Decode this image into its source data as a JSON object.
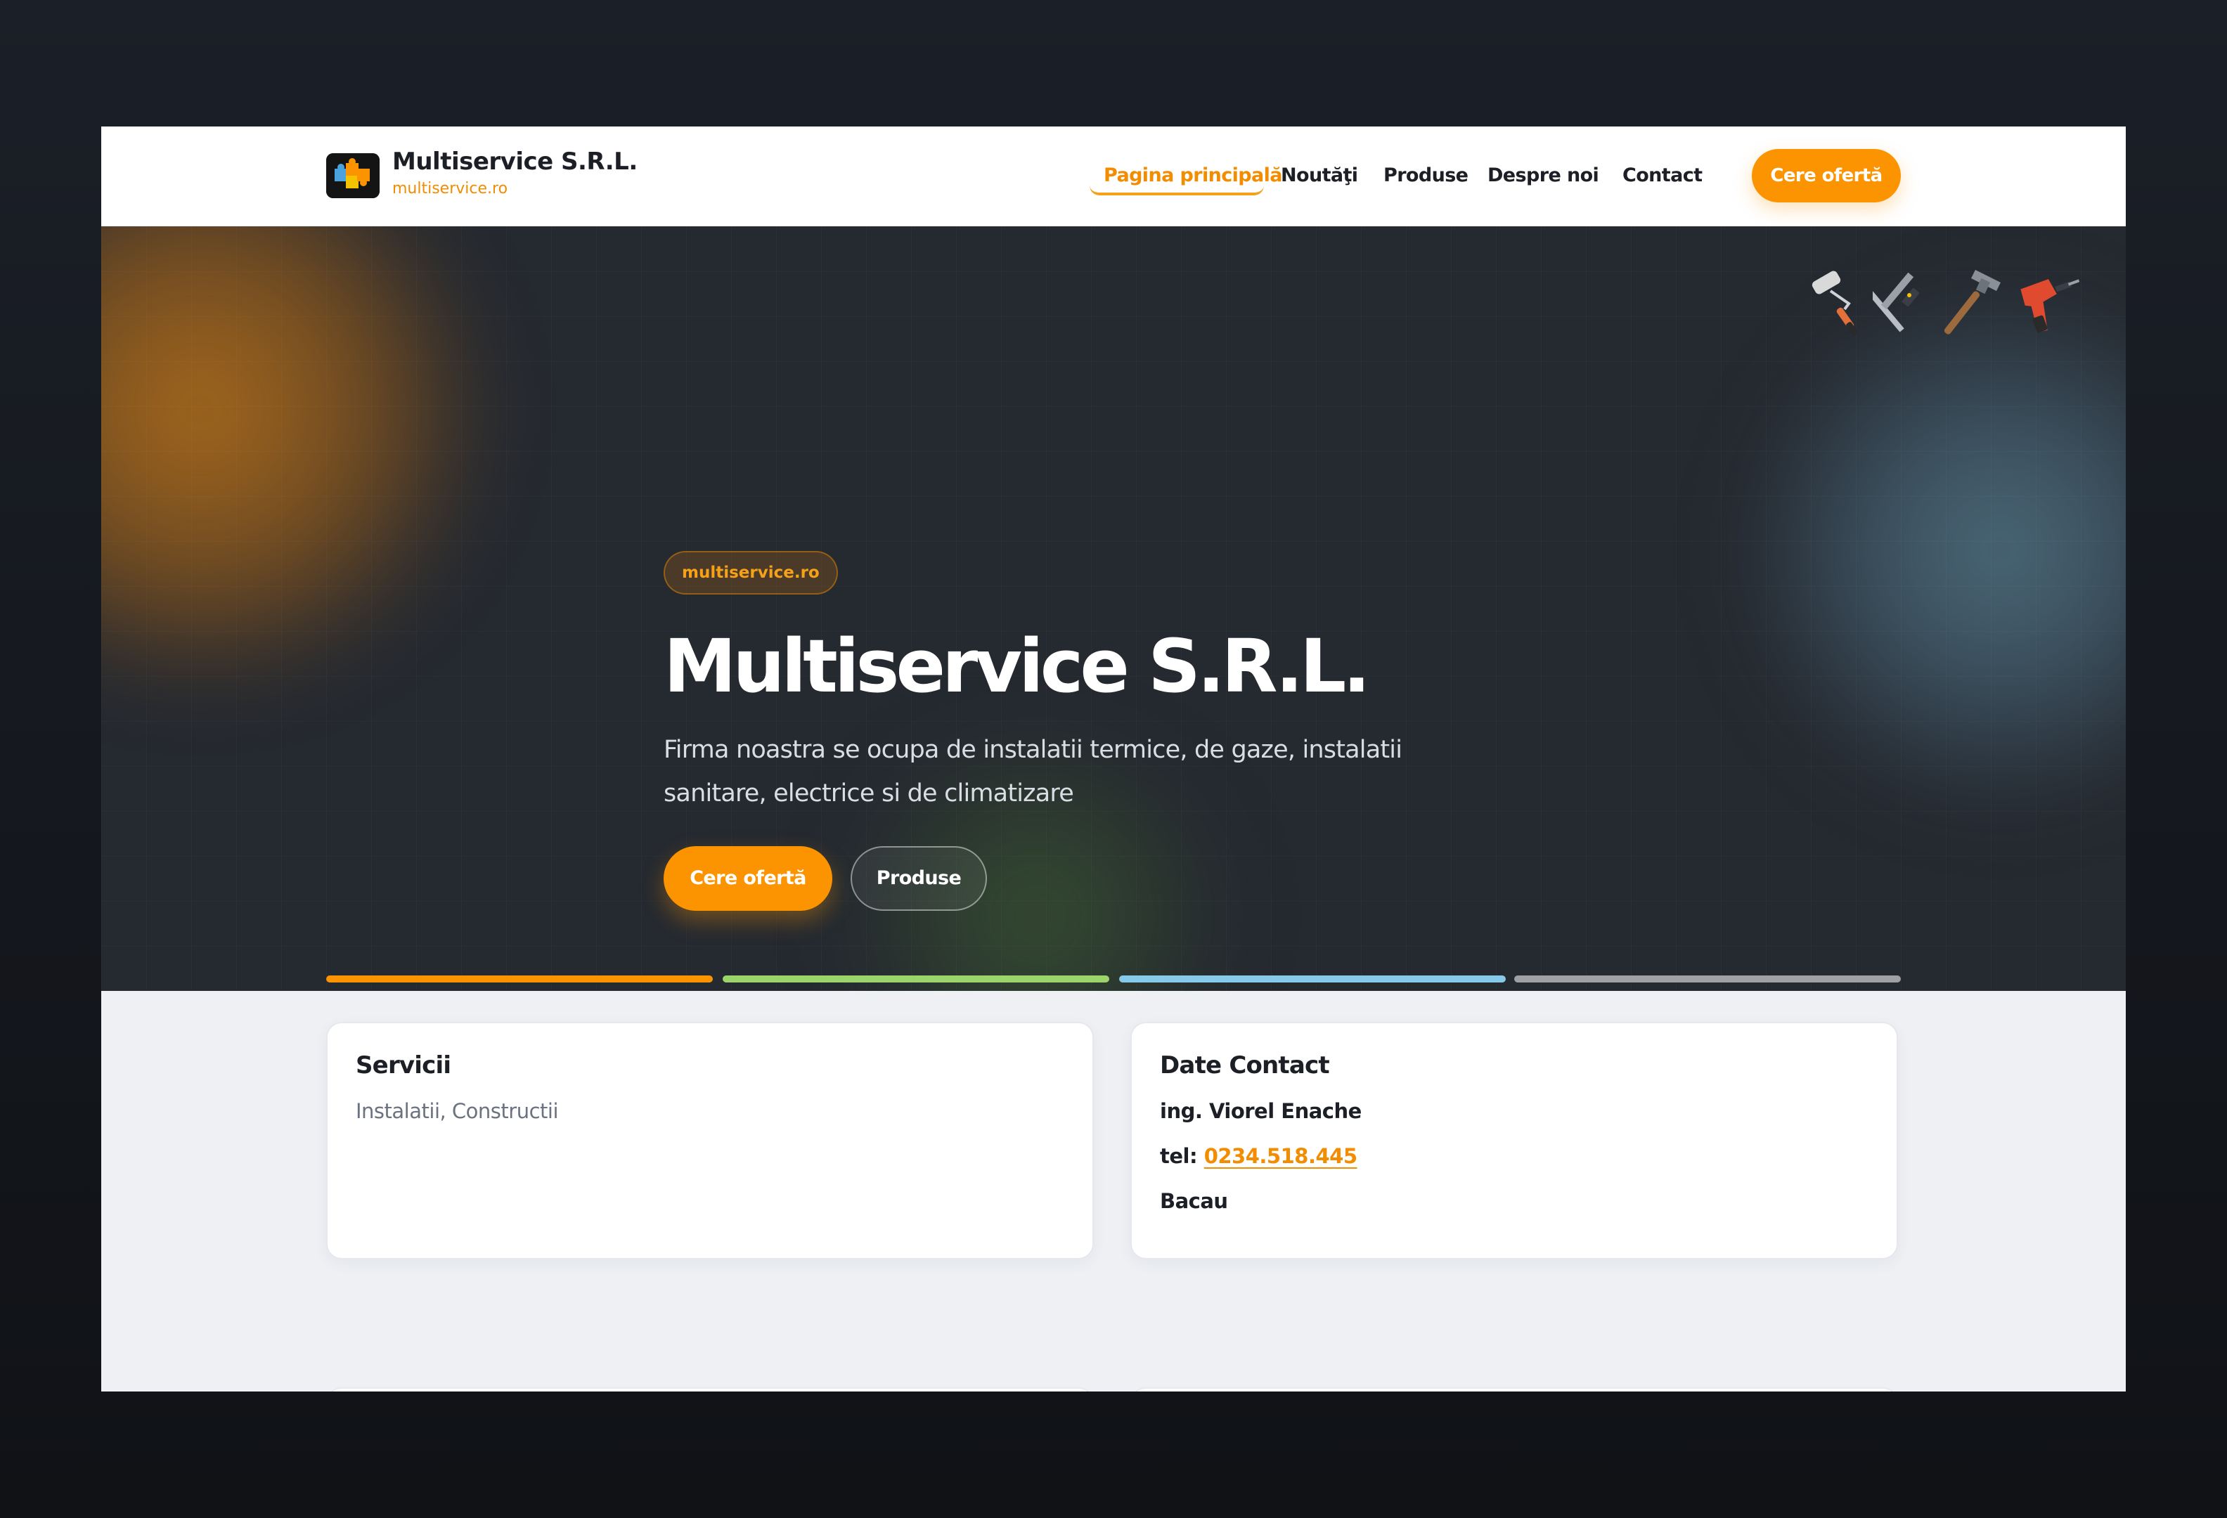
{
  "header": {
    "brand_name": "Multiservice S.R.L.",
    "brand_domain": "multiservice.ro",
    "nav": [
      {
        "label": "Pagina principală",
        "active": true
      },
      {
        "label": "Noutăţi",
        "active": false
      },
      {
        "label": "Produse",
        "active": false
      },
      {
        "label": "Despre noi",
        "active": false
      },
      {
        "label": "Contact",
        "active": false
      }
    ],
    "cta_label": "Cere ofertă"
  },
  "hero": {
    "badge": "multiservice.ro",
    "title": "Multiservice S.R.L.",
    "subtitle": "Firma noastra se ocupa de instalatii termice, de gaze, instalatii sanitare, electrice si de climatizare",
    "primary_button": "Cere ofertă",
    "secondary_button": "Produse",
    "tool_icons": [
      "paint-roller-icon",
      "square-ruler-icon",
      "hammer-icon",
      "drill-icon"
    ],
    "accent_bars": [
      "#fb9400",
      "#9bd46a",
      "#86c9e8",
      "#9ea0a4"
    ]
  },
  "services_card": {
    "title": "Servicii",
    "text": "Instalatii, Constructii"
  },
  "contact_card": {
    "title": "Date Contact",
    "person": "ing. Viorel Enache",
    "phone_prefix": "tel:",
    "phone": "0234.518.445",
    "city": "Bacau"
  },
  "colors": {
    "accent": "#fb9400",
    "hero_bg": "#252930",
    "page_bg": "#eef0f4"
  }
}
